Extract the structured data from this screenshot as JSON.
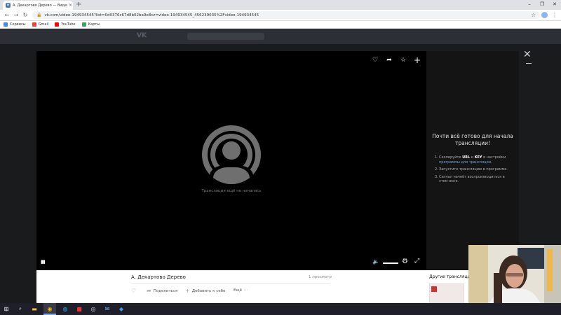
{
  "browser": {
    "tab_title": "А. Декартово Дерево — Видео",
    "tab_close": "×",
    "new_tab": "+",
    "url": "vk.com/video-194934545?list=0d0376c67d8b02ba9e8cz=video-194934545_456239035%2Fvideo-194934545",
    "window_controls": [
      "–",
      "❐",
      "✕"
    ],
    "bookmarks": [
      {
        "label": "Сервисы",
        "color": "#4285f4"
      },
      {
        "label": "Gmail",
        "color": "#ea4335"
      },
      {
        "label": "YouTube",
        "color": "#ff0000"
      },
      {
        "label": "Карты",
        "color": "#34a853"
      }
    ]
  },
  "vk": {
    "logo": "VK"
  },
  "player": {
    "status_text": "Трансляция ещё не началась",
    "top_actions": [
      "heart-icon",
      "share-icon",
      "star-icon",
      "plus-icon"
    ]
  },
  "side_panel": {
    "title": "Почти всё готово для начала трансляции!",
    "steps": [
      {
        "n": "1.",
        "pre": "Скопируйте ",
        "url": "URL",
        "mid": " и ",
        "key": "KEY",
        "post": " в настройки ",
        "link": "программы для трансляции",
        "end": "."
      },
      {
        "n": "2.",
        "text": "Запустите трансляцию в программе."
      },
      {
        "n": "3.",
        "text": "Сигнал начнёт воспроизводиться в этом окне."
      }
    ]
  },
  "info": {
    "title": "А. Декартово Дерево",
    "views": "1 просмотр",
    "actions": {
      "share": "Поделиться",
      "add": "Добавить к себе",
      "more": "Ещё"
    }
  },
  "other": {
    "title": "Другие трансляции"
  }
}
